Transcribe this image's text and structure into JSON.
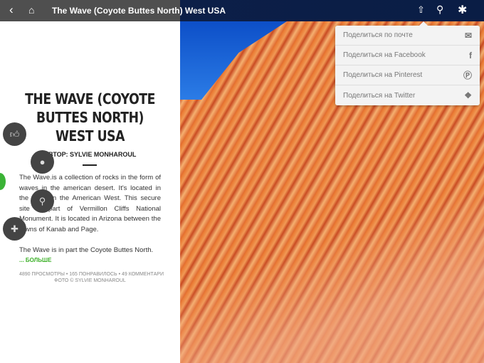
{
  "header": {
    "title": "The Wave (Coyote Buttes North) West USA"
  },
  "article": {
    "title": "THE WAVE (COYOTE BUTTES NORTH) WEST USA",
    "author": "АВТОР: SYLVIE MONHAROUL",
    "paragraph1": "The Wave.is a collection of rocks in the form of waves in the american desert. It's located in the USA, in the American West. This secure site is part of Vermillon Cliffs National Monument. It is located in Arizona between the towns of Kanab and Page.",
    "paragraph2": "The Wave is in part the Coyote Buttes North.",
    "more": "... БОЛЬШЕ",
    "stats": "4890 ПРОСМОТРЫ  •  165 ПОНРАВИЛОСЬ  •  49 КОММЕНТАРИ",
    "credit": "ФОТО © SYLVIE MONHAROUL"
  },
  "share_menu": [
    {
      "label": "Поделиться по почте",
      "icon": "mail-icon"
    },
    {
      "label": "Поделиться на Facebook",
      "icon": "facebook-icon"
    },
    {
      "label": "Поделиться на Pinterest",
      "icon": "pinterest-icon"
    },
    {
      "label": "Поделиться на Twitter",
      "icon": "twitter-icon"
    }
  ]
}
